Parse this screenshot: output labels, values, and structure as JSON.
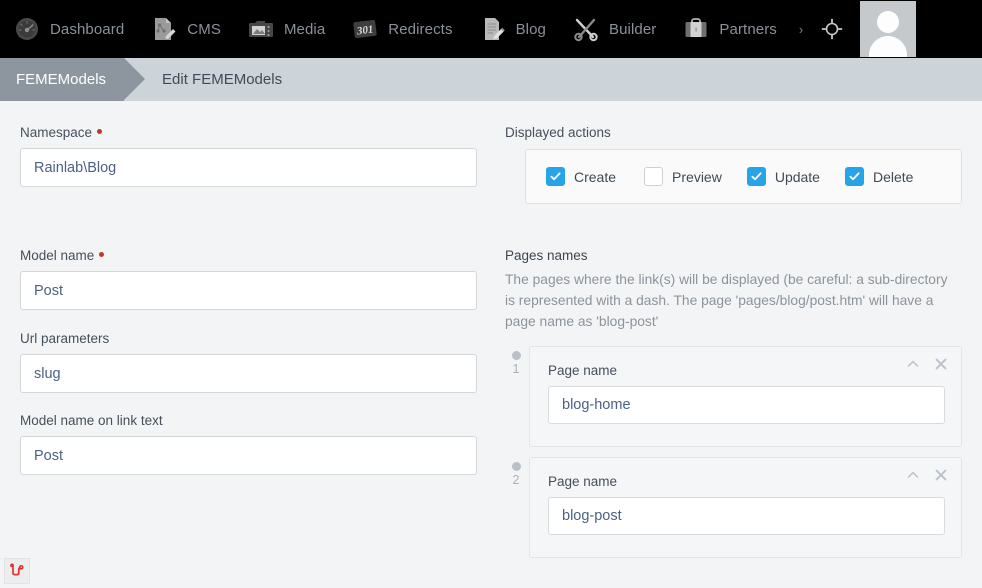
{
  "topnav": {
    "items": [
      {
        "label": "Dashboard",
        "icon": "gauge-icon"
      },
      {
        "label": "CMS",
        "icon": "cms-page-edit-icon"
      },
      {
        "label": "Media",
        "icon": "camera-image-icon"
      },
      {
        "label": "Redirects",
        "icon": "301-redirect-icon"
      },
      {
        "label": "Blog",
        "icon": "document-pencil-icon"
      },
      {
        "label": "Builder",
        "icon": "hammer-wrench-icon"
      },
      {
        "label": "Partners",
        "icon": "briefcase-icon"
      }
    ],
    "more_chevron": "›",
    "target_icon": "crosshair-target-icon",
    "avatar_icon": "user-avatar-icon"
  },
  "breadcrumb": {
    "parent": "FEMEModels",
    "current": "Edit FEMEModels"
  },
  "form": {
    "namespace": {
      "label": "Namespace",
      "required": true,
      "value": "Rainlab\\Blog",
      "placeholder": ""
    },
    "model_name": {
      "label": "Model name",
      "required": true,
      "value": "Post",
      "placeholder": ""
    },
    "url_parameters": {
      "label": "Url parameters",
      "required": false,
      "value": "slug",
      "placeholder": ""
    },
    "model_name_link_text": {
      "label": "Model name on link text",
      "required": false,
      "value": "Post",
      "placeholder": ""
    }
  },
  "displayed_actions": {
    "label": "Displayed actions",
    "options": [
      {
        "label": "Create",
        "checked": true
      },
      {
        "label": "Preview",
        "checked": false
      },
      {
        "label": "Update",
        "checked": true
      },
      {
        "label": "Delete",
        "checked": true
      }
    ]
  },
  "pages_names": {
    "label": "Pages names",
    "description": "The pages where the link(s) will be displayed (be careful: a sub-directory is represented with a dash. The page 'pages/blog/post.htm' will have a page name as 'blog-post'",
    "items": [
      {
        "index": "1",
        "field_label": "Page name",
        "value": "blog-home",
        "collapse_icon": "chevron-up-icon",
        "remove_icon": "close-x-icon"
      },
      {
        "index": "2",
        "field_label": "Page name",
        "value": "blog-post",
        "collapse_icon": "chevron-up-icon",
        "remove_icon": "close-x-icon"
      }
    ]
  },
  "corner": {
    "logo_icon": "laravel-logo-icon"
  },
  "colors": {
    "nav_bg": "#000000",
    "nav_text": "#8b9199",
    "breadcrumb_bg": "#ccd3d9",
    "breadcrumb_parent_bg": "#8d969e",
    "page_bg": "#f3f4f5",
    "input_text": "#4c6184",
    "label_text": "#46505b",
    "accent_checkbox": "#27a3e8",
    "required_dot": "#c0392b",
    "logo_red": "#dd3333"
  }
}
